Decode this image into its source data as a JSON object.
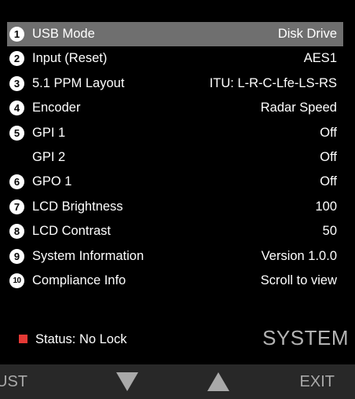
{
  "menu": {
    "items": [
      {
        "num": "1",
        "label": "USB Mode",
        "value": "Disk Drive",
        "selected": true
      },
      {
        "num": "2",
        "label": "Input (Reset)",
        "value": "AES1"
      },
      {
        "num": "3",
        "label": "5.1 PPM Layout",
        "value": "ITU: L-R-C-Lfe-LS-RS"
      },
      {
        "num": "4",
        "label": "Encoder",
        "value": "Radar Speed"
      },
      {
        "num": "5",
        "label": "GPI 1",
        "value": "Off"
      },
      {
        "num": "",
        "label": "GPI 2",
        "value": "Off"
      },
      {
        "num": "6",
        "label": "GPO 1",
        "value": "Off"
      },
      {
        "num": "7",
        "label": "LCD Brightness",
        "value": "100"
      },
      {
        "num": "8",
        "label": "LCD Contrast",
        "value": "50"
      },
      {
        "num": "9",
        "label": "System Information",
        "value": "Version 1.0.0"
      },
      {
        "num": "10",
        "label": "Compliance Info",
        "value": "Scroll to view"
      }
    ]
  },
  "status": {
    "text": "Status: No Lock",
    "indicator_color": "#e53935"
  },
  "section_title": "SYSTEM",
  "softkeys": {
    "left_label": "UST",
    "down_icon": "triangle-down-icon",
    "up_icon": "triangle-up-icon",
    "exit_label": "EXIT"
  }
}
